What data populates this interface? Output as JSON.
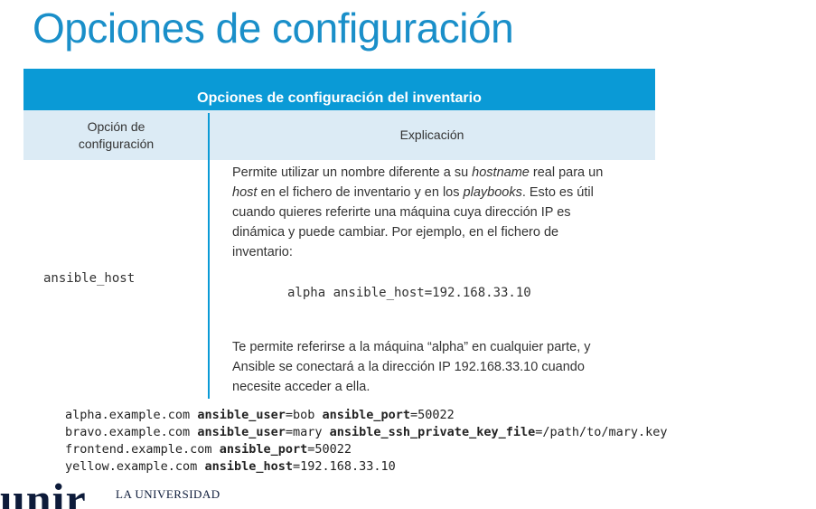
{
  "slide": {
    "title": "Opciones de configuración"
  },
  "table": {
    "caption": "Opciones de configuración del inventario",
    "col1_header_line1": "Opción de",
    "col1_header_line2": "configuración",
    "col2_header": "Explicación",
    "option": "ansible_host",
    "explanation_lines": [
      [
        "Permite utilizar un nombre diferente a su ",
        "hostname",
        " real para un"
      ],
      [
        "",
        "host",
        " en el fichero de inventario y en los ",
        "playbooks",
        ". Esto es útil"
      ],
      [
        "cuando quieres referirte una máquina cuya dirección IP es"
      ],
      [
        "dinámica y puede cambiar. Por ejemplo, en el fichero de"
      ],
      [
        "inventario:"
      ]
    ],
    "example": "alpha ansible_host=192.168.33.10",
    "explanation2_lines": [
      "Te permite referirse a la máquina “alpha” en cualquier parte, y",
      "Ansible se conectará a la dirección IP 192.168.33.10 cuando",
      "necesite acceder a ella."
    ]
  },
  "code": {
    "lines": [
      [
        [
          "alpha.example.com ",
          false
        ],
        [
          "ansible_user",
          true
        ],
        [
          "=bob ",
          false
        ],
        [
          "ansible_port",
          true
        ],
        [
          "=50022",
          false
        ]
      ],
      [
        [
          "bravo.example.com ",
          false
        ],
        [
          "ansible_user",
          true
        ],
        [
          "=mary ",
          false
        ],
        [
          "ansible_ssh_private_key_file",
          true
        ],
        [
          "=/path/to/mary.key",
          false
        ]
      ],
      [
        [
          "frontend.example.com ",
          false
        ],
        [
          "ansible_port",
          true
        ],
        [
          "=50022",
          false
        ]
      ],
      [
        [
          "yellow.example.com ",
          false
        ],
        [
          "ansible_host",
          true
        ],
        [
          "=192.168.33.10",
          false
        ]
      ]
    ]
  },
  "logo": {
    "mark": "unir",
    "tagline": "LA UNIVERSIDAD"
  }
}
